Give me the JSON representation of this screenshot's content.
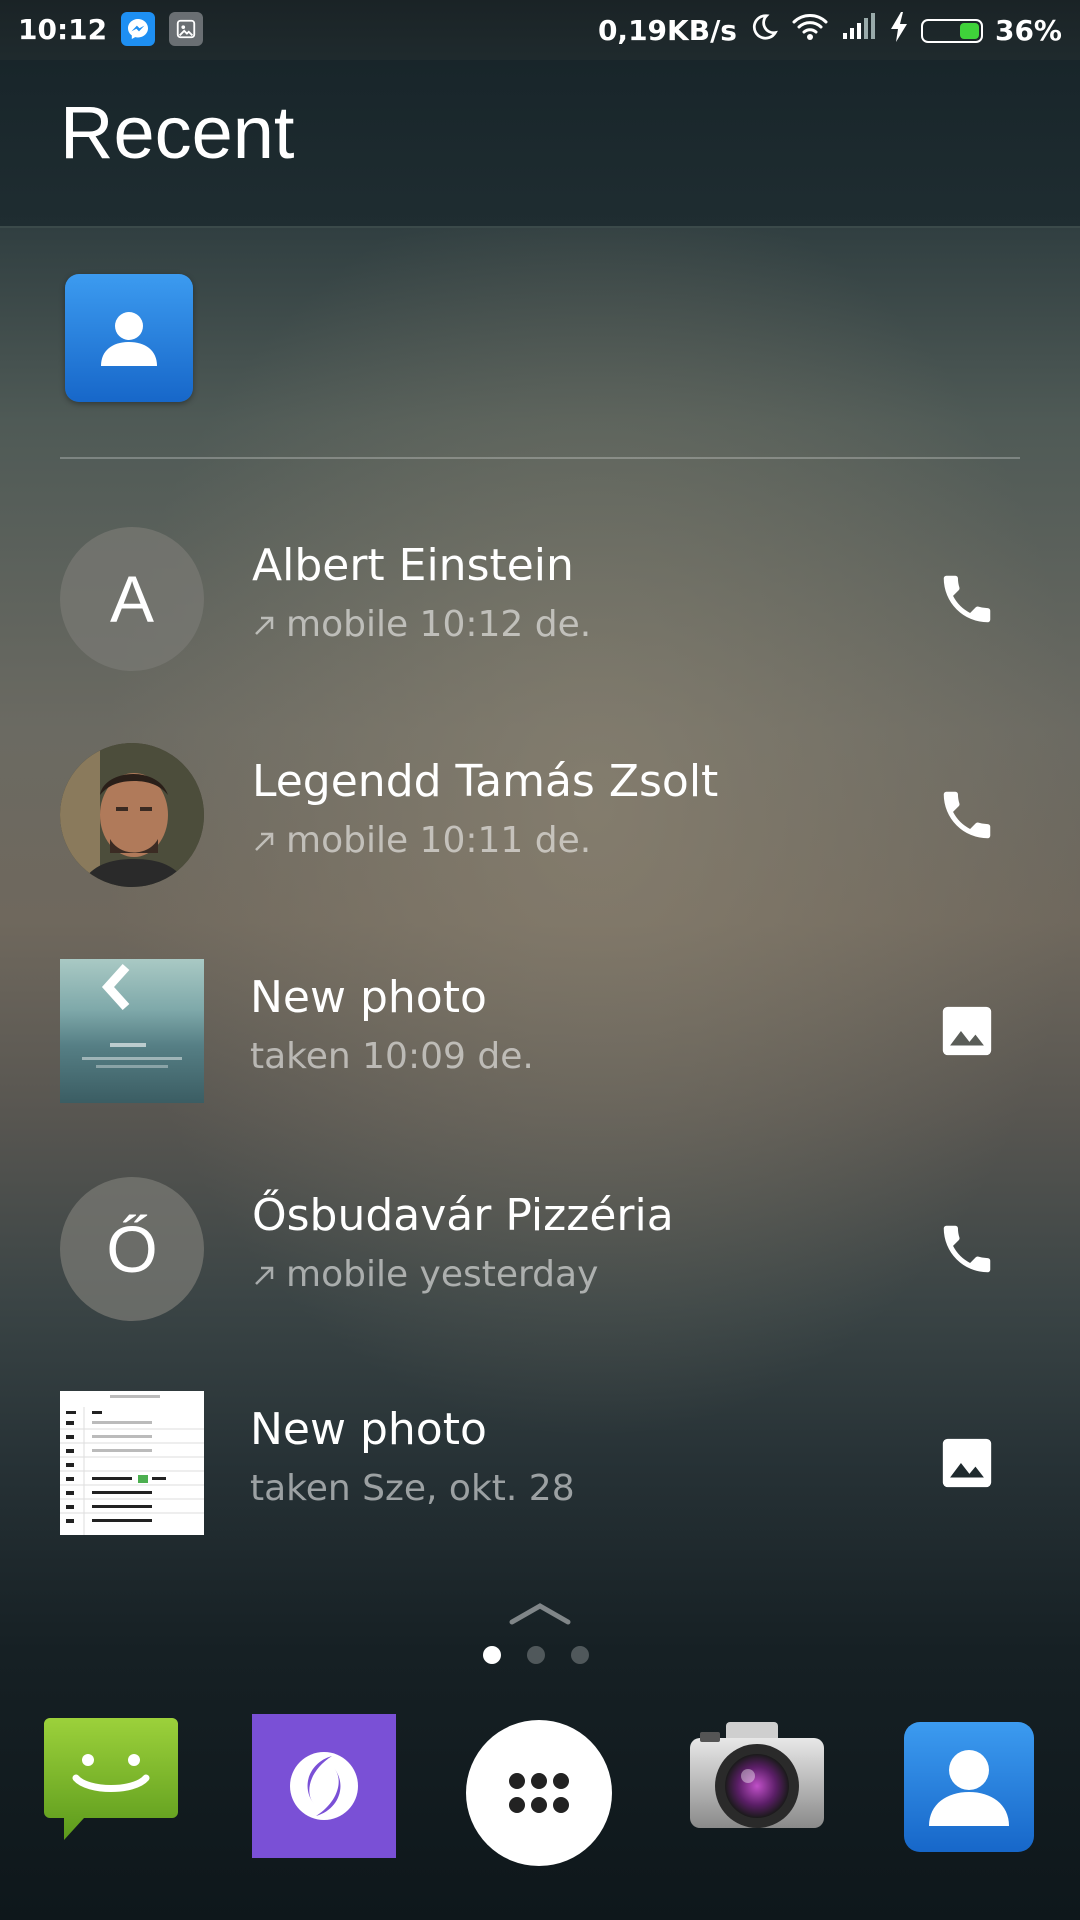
{
  "status_bar": {
    "time": "10:12",
    "net_speed": "0,19KB/s",
    "battery_percent": "36%",
    "battery_level": 0.36,
    "notification_icons": [
      "messenger-icon",
      "gallery-icon"
    ],
    "system_icons": [
      "moon-icon",
      "wifi-icon",
      "signal-icon",
      "charging-bolt-icon",
      "battery-icon"
    ]
  },
  "header": {
    "title": "Recent"
  },
  "pinned_app": {
    "icon": "contacts-icon"
  },
  "recent_items": [
    {
      "avatar_letter": "A",
      "title": "Albert Einstein",
      "subtitle": "mobile 10:12 de.",
      "type": "call",
      "action_icon": "phone-icon",
      "outgoing": true
    },
    {
      "avatar_letter": "",
      "title": "Legendd Tamás Zsolt",
      "subtitle": "mobile 10:11 de.",
      "type": "call",
      "action_icon": "phone-icon",
      "outgoing": true
    },
    {
      "avatar_letter": "",
      "title": "New photo",
      "subtitle": "taken 10:09 de.",
      "type": "photo",
      "action_icon": "image-icon",
      "outgoing": false
    },
    {
      "avatar_letter": "Ő",
      "title": "Ősbudavár Pizzéria",
      "subtitle": "mobile yesterday",
      "type": "call",
      "action_icon": "phone-icon",
      "outgoing": true
    },
    {
      "avatar_letter": "",
      "title": "New photo",
      "subtitle": "taken Sze, okt. 28",
      "type": "photo",
      "action_icon": "image-icon",
      "outgoing": false
    }
  ],
  "pager": {
    "pages": 3,
    "active": 0
  },
  "dock": [
    {
      "icon": "messages-icon"
    },
    {
      "icon": "purple-app-icon"
    },
    {
      "icon": "app-drawer-icon"
    },
    {
      "icon": "camera-icon"
    },
    {
      "icon": "contacts-icon"
    }
  ]
}
